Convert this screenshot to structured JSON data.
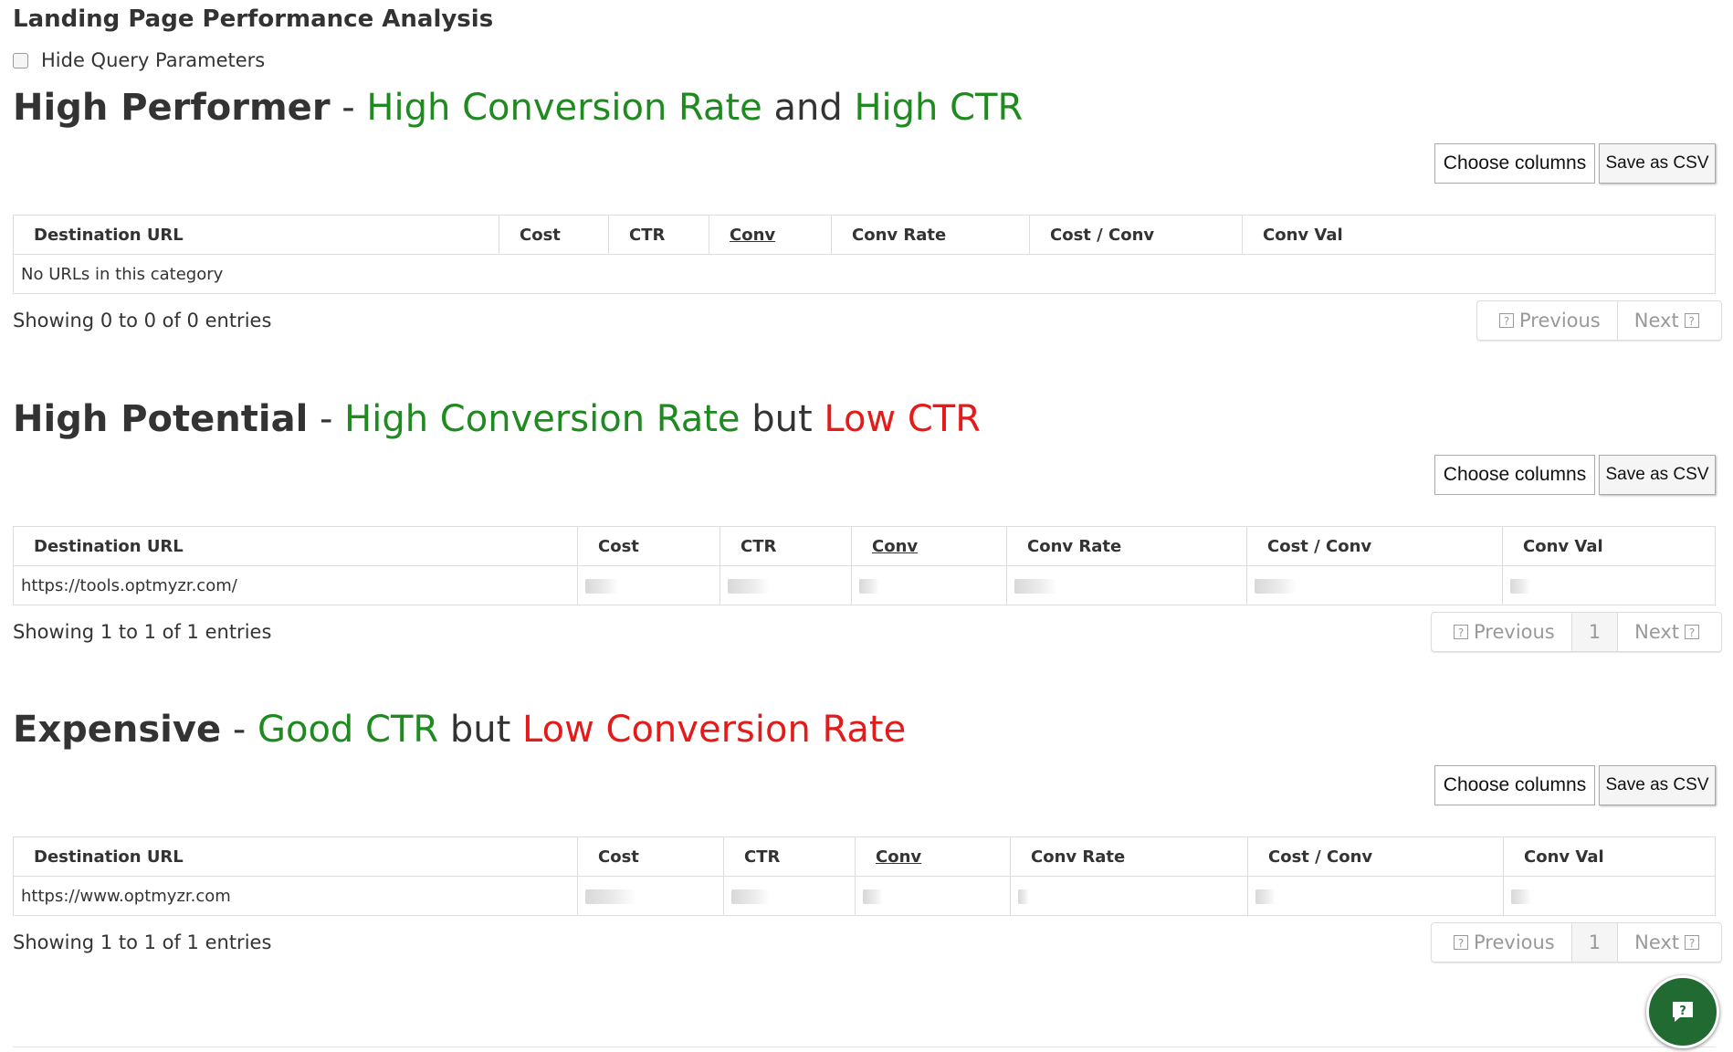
{
  "page_title": "Landing Page Performance Analysis",
  "hide_query_label": "Hide Query Parameters",
  "buttons": {
    "choose_columns": "Choose columns",
    "save_csv": "Save as CSV"
  },
  "table_headers": [
    "Destination URL",
    "Cost",
    "CTR",
    "Conv",
    "Conv Rate",
    "Cost / Conv",
    "Conv Val"
  ],
  "pager": {
    "previous": "Previous",
    "next": "Next",
    "page": "1",
    "help_glyph": "?"
  },
  "sections": [
    {
      "name": "High Performer",
      "sep": "-",
      "part1": "High Conversion Rate",
      "joiner": "and",
      "part2": "High CTR",
      "part1_color": "green",
      "part2_color": "green",
      "row_text": "No URLs in this category",
      "showing": "Showing 0 to 0 of 0 entries"
    },
    {
      "name": "High Potential",
      "sep": "-",
      "part1": "High Conversion Rate",
      "joiner": "but",
      "part2": "Low CTR",
      "part1_color": "green",
      "part2_color": "red",
      "row_text": "https://tools.optmyzr.com/",
      "showing": "Showing 1 to 1 of 1 entries"
    },
    {
      "name": "Expensive",
      "sep": "-",
      "part1": "Good CTR",
      "joiner": "but",
      "part2": "Low Conversion Rate",
      "part1_color": "green",
      "part2_color": "red",
      "row_text": "https://www.optmyzr.com",
      "showing": "Showing 1 to 1 of 1 entries"
    }
  ],
  "colors": {
    "green": "#1f8a1f",
    "red": "#e31b1b",
    "chat_button": "#216a32"
  },
  "icons": {
    "chat": "chat-help-icon",
    "help": "help-box-icon"
  }
}
